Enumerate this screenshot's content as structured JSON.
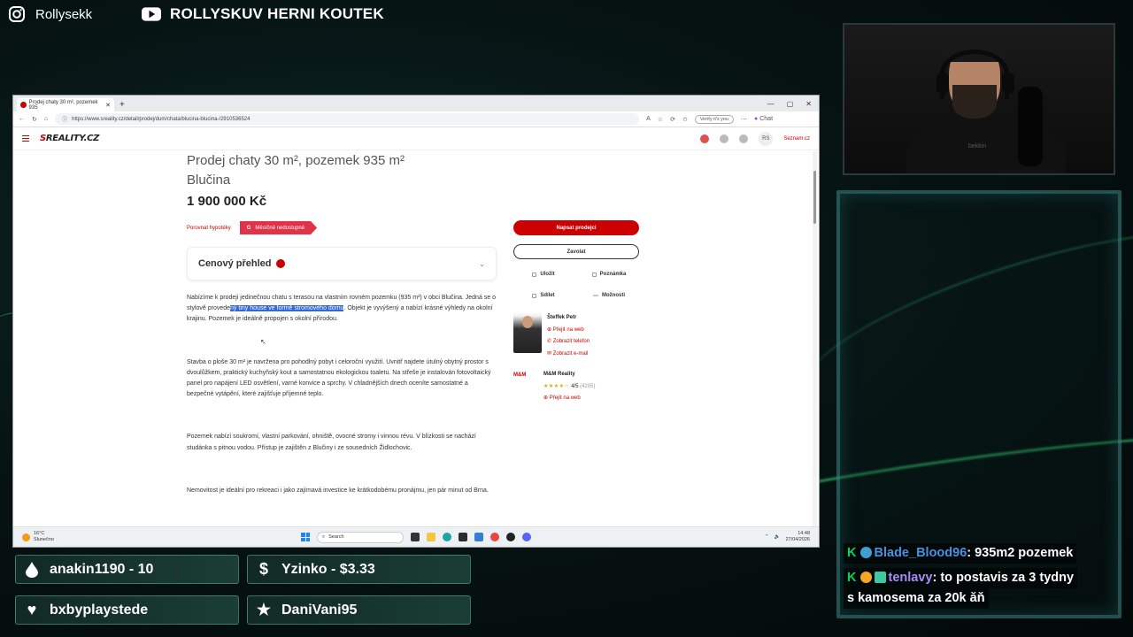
{
  "overlay": {
    "instagram_handle": "Rollysekk",
    "youtube_channel": "ROLLYSKUV HERNI KOUTEK",
    "goals": [
      {
        "icon": "drop-icon",
        "text": "anakin1190 - 10"
      },
      {
        "icon": "dollar-icon",
        "text": "Yzinko - $3.33"
      },
      {
        "icon": "heart-icon",
        "text": "bxbyplaystede"
      },
      {
        "icon": "star-icon",
        "text": "DaniVani95"
      }
    ]
  },
  "webcam": {
    "shirt_text": "bekkin"
  },
  "chat": {
    "messages": [
      {
        "user": "Blade_Blood96",
        "text": ": 935m2 pozemek"
      },
      {
        "user": "tenlavy",
        "text": ": to postavis za 3 tydny",
        "text2": "s kamosema za 20k ăň"
      }
    ]
  },
  "browser": {
    "tab_title": "Prodej chaty 30 m², pozemek 935",
    "url": "https://www.sreality.cz/detail/prodej/dum/chata/blucina-blucina-/2910536524",
    "profile_pill": "Verify it's you",
    "chat_label": "Chat",
    "site": {
      "logo_prefix": "S",
      "logo_rest": "REALITY.CZ",
      "avatar_initials": "RS",
      "account_label": "Seznam.cz"
    },
    "listing": {
      "title_line1": "Prodej chaty 30 m², pozemek 935 m²",
      "title_line2": "Blučina",
      "price": "1 900 000 Kč",
      "compare_mortgage": "Porovnat hypotéky",
      "mortgage_banner": "Měsíčně nedostupné",
      "price_overview": "Cenový přehled",
      "para1_a": "Nabízíme k prodeji jedinečnou chatu s terasou na vlastním rovném pozemku (935 m²) v obci Blučina. Jedná se o stylově provede",
      "para1_hl": "ný tiny house ve formě stromového domu",
      "para1_b": ". Objekt je vyvýšený a nabízí krásné výhledy na okolní krajinu. Pozemek je ideálně propojen s okolní přírodou.",
      "para2": "Stavba o ploše 30 m² je navržena pro pohodlný pobyt i celoroční využití. Uvnitř najdete útulný obytný prostor s dvoulůžkem, praktický kuchyňský kout a samostatnou ekologickou toaletu. Na střeše je instalován fotovoltaický panel pro napájení LED osvětlení, varné konvice a sprchy. V chladnějších dnech oceníte samostatné a bezpečné vytápění, které zajišťuje příjemné teplo.",
      "para3": "Pozemek nabízí soukromí, vlastní parkování, ohniště, ovocné stromy i vinnou révu. V blízkosti se nachází studánka s pitnou vodou. Přístup je zajištěn z Blučiny i ze sousedních Židlochovic.",
      "para4": "Nemovitost je ideální pro rekreaci i jako zajímavá investice ke krátkodobému pronájmu, jen pár minut od Brna."
    },
    "sidebar": {
      "write_seller": "Napsat prodejci",
      "call": "Zavolat",
      "save": "Uložit",
      "note": "Poznámka",
      "share": "Sdílet",
      "options": "Možnosti",
      "agent_name": "Šteffek Petr",
      "agent_web": "Přejít na web",
      "agent_phone": "Zobrazit telefon",
      "agent_email": "Zobrazit e-mail",
      "agency_name": "M&M Reality",
      "agency_logo": "M&M",
      "agency_rating": "4/5",
      "agency_reviews": "(4205)",
      "agency_web": "Přejít na web"
    },
    "taskbar": {
      "temp": "16°C",
      "weather": "Slunečno",
      "search_placeholder": "Search",
      "time": "14:48",
      "date": "27/04/2026"
    }
  }
}
